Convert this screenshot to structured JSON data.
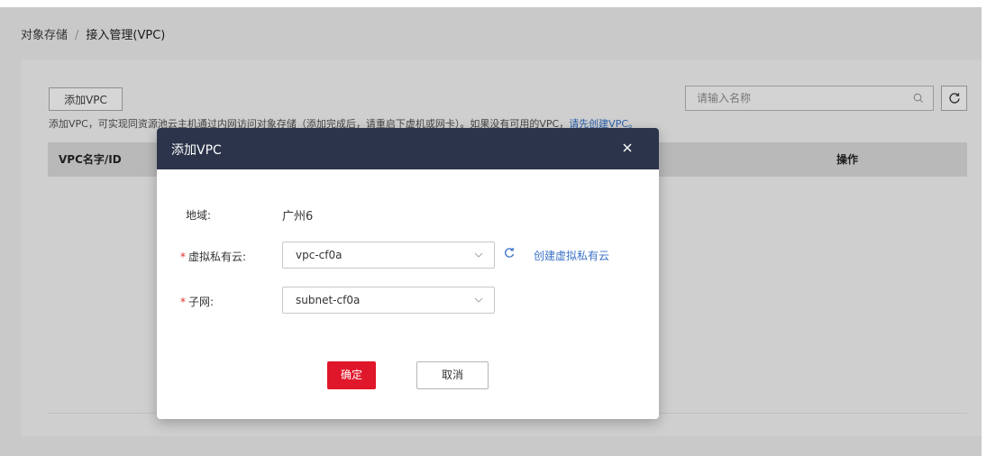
{
  "breadcrumb": {
    "root": "对象存储",
    "separator": "/",
    "current": "接入管理(VPC)"
  },
  "toolbar": {
    "add_label": "添加VPC",
    "hint_text": "添加VPC，可实现同资源池云主机通过内网访问对象存储（添加完成后，请重启下虚机或网卡）。如果没有可用的VPC，",
    "hint_link": "请先创建VPC。",
    "search_placeholder": "请输入名称"
  },
  "table": {
    "columns": [
      "VPC名字/ID",
      "操作"
    ]
  },
  "modal": {
    "title": "添加VPC",
    "region_label": "地域:",
    "region_value": "广州6",
    "vpc_label": "虚拟私有云:",
    "vpc_value": "vpc-cf0a",
    "create_vpc_link": "创建虚拟私有云",
    "subnet_label": "子网:",
    "subnet_value": "subnet-cf0a",
    "required_mark": "*",
    "ok_label": "确定",
    "cancel_label": "取消"
  },
  "icons": {
    "close": "close-icon",
    "search": "search-icon",
    "refresh": "refresh-icon",
    "dropdown": "chevron-down-icon"
  },
  "colors": {
    "primary_button": "#e0172b",
    "modal_header": "#2b344a",
    "link": "#3b73c7",
    "required": "#e03030"
  }
}
